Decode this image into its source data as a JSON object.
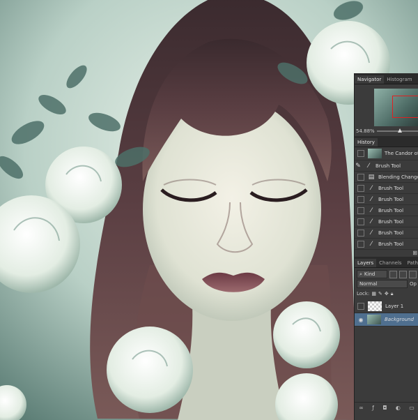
{
  "canvas": {
    "description_icon": "portrait-artwork-icon"
  },
  "navigator": {
    "tabs": [
      {
        "label": "Navigator"
      },
      {
        "label": "Histogram"
      }
    ],
    "zoom": "54.88%"
  },
  "history": {
    "tab": "History",
    "snapshot": "The Candor of th",
    "items": [
      {
        "label": "Brush Tool",
        "icon": "brush-icon"
      },
      {
        "label": "Blending Change",
        "icon": "document-icon"
      },
      {
        "label": "Brush Tool",
        "icon": "brush-icon"
      },
      {
        "label": "Brush Tool",
        "icon": "brush-icon"
      },
      {
        "label": "Brush Tool",
        "icon": "brush-icon"
      },
      {
        "label": "Brush Tool",
        "icon": "brush-icon"
      },
      {
        "label": "Brush Tool",
        "icon": "brush-icon"
      },
      {
        "label": "Brush Tool",
        "icon": "brush-icon"
      }
    ]
  },
  "layers": {
    "tabs": [
      {
        "label": "Layers"
      },
      {
        "label": "Channels"
      },
      {
        "label": "Paths"
      }
    ],
    "filter": "Kind",
    "blend_mode": "Normal",
    "opacity_label": "Op",
    "lock_label": "Lock:",
    "items": [
      {
        "label": "Layer 1"
      },
      {
        "label": "Background"
      }
    ]
  },
  "colors": {
    "panel_bg": "#3b3b3b",
    "selection": "#4f6f8f",
    "navigator_box": "#e02020"
  }
}
